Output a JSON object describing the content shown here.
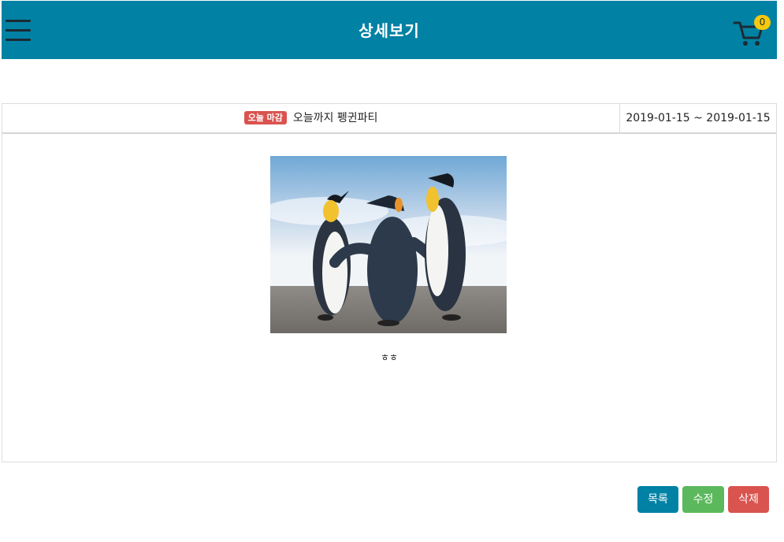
{
  "header": {
    "title": "상세보기",
    "cart_count": "0",
    "color": "#0181a4"
  },
  "event": {
    "badge": "오늘 마감",
    "title": "오늘까지 펭귄파티",
    "date_range": "2019-01-15 ~ 2019-01-15",
    "content": "ㅎㅎ"
  },
  "buttons": {
    "list": "목록",
    "edit": "수정",
    "delete": "삭제"
  },
  "icons": {
    "menu": "hamburger-menu-icon",
    "cart": "shopping-cart-icon"
  },
  "colors": {
    "primary": "#0181a4",
    "success": "#5cb85c",
    "danger": "#d9534f",
    "badge": "#f6c90e"
  }
}
